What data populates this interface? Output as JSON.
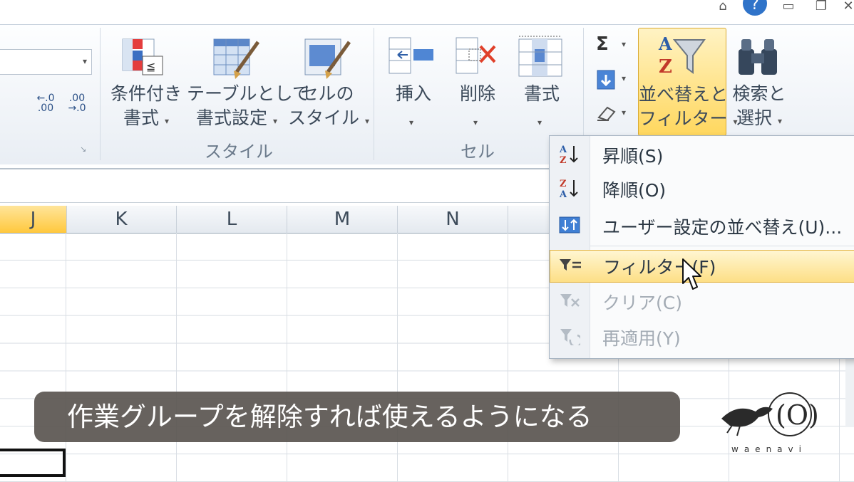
{
  "colors": {
    "accent": "#ffd75e",
    "caption_bg": "#5a5550",
    "selected_col": "#ffd54f"
  },
  "ribbon": {
    "number": {
      "inc_decimal": "←.0\n.00",
      "inc_label": "←.0",
      "inc_sub": ".00",
      "dec_label": ".00",
      "dec_sub": "→.0"
    },
    "styles": {
      "conditional_formatting": {
        "line1": "条件付き",
        "line2": "書式"
      },
      "format_as_table": {
        "line1": "テーブルとして",
        "line2": "書式設定"
      },
      "cell_styles": {
        "line1": "セルの",
        "line2": "スタイル"
      },
      "group_label": "スタイル"
    },
    "cells": {
      "insert": "挿入",
      "delete": "削除",
      "format": "書式",
      "group_label": "セル"
    },
    "editing": {
      "sum_symbol": "Σ",
      "sort_filter": {
        "line1": "並べ替えと",
        "line2": "フィルター"
      },
      "find_select": {
        "line1": "検索と",
        "line2": "選択"
      }
    },
    "dropdown_arrow": "▾"
  },
  "columns": [
    "J",
    "K",
    "L",
    "M",
    "N"
  ],
  "menu": {
    "items": [
      {
        "label": "昇順(S)",
        "icon": "sort-ascending-icon"
      },
      {
        "label": "降順(O)",
        "icon": "sort-descending-icon"
      },
      {
        "label": "ユーザー設定の並べ替え(U)...",
        "icon": "custom-sort-icon"
      },
      {
        "label": "フィルター(F)",
        "icon": "filter-icon"
      },
      {
        "label": "クリア(C)",
        "icon": "clear-filter-icon"
      },
      {
        "label": "再適用(Y)",
        "icon": "reapply-icon"
      }
    ]
  },
  "caption": "作業グループを解除すれば使えるようになる",
  "logo_text": "waenavi"
}
